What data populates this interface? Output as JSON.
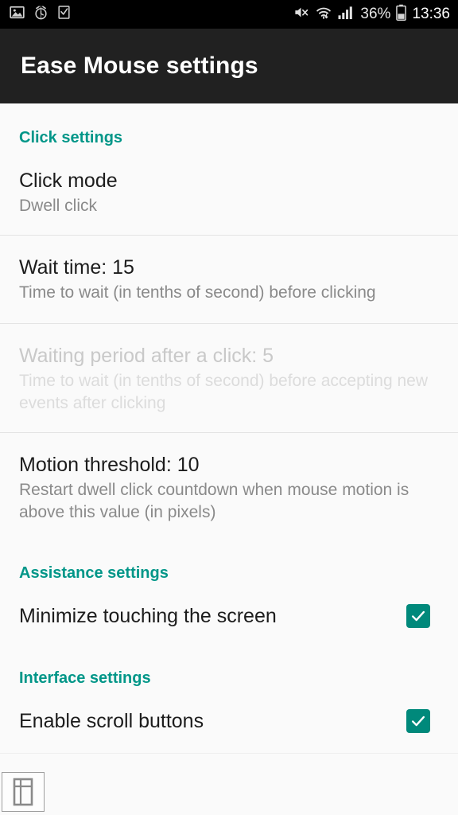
{
  "status_bar": {
    "left_icons": [
      "image-icon",
      "alarm-icon",
      "task-checkbox-icon"
    ],
    "right_icons": [
      "mute-icon",
      "wifi-icon",
      "signal-icon",
      "battery-icon"
    ],
    "battery_percent": "36%",
    "clock": "13:36"
  },
  "toolbar": {
    "title": "Ease Mouse settings"
  },
  "sections": [
    {
      "header": "Click settings",
      "items": [
        {
          "title": "Click mode",
          "summary": "Dwell click",
          "enabled": true,
          "type": "list"
        },
        {
          "title": "Wait time: 15",
          "summary": "Time to wait (in tenths of second) before clicking",
          "enabled": true,
          "type": "seekbar"
        },
        {
          "title": "Waiting period after a click: 5",
          "summary": "Time to wait (in tenths of second) before accepting new events after clicking",
          "enabled": false,
          "type": "seekbar"
        },
        {
          "title": "Motion threshold: 10",
          "summary": "Restart dwell click countdown when mouse motion is above this value (in pixels)",
          "enabled": true,
          "type": "seekbar"
        }
      ]
    },
    {
      "header": "Assistance settings",
      "items": [
        {
          "title": "Minimize touching the screen",
          "summary": "",
          "enabled": true,
          "type": "checkbox",
          "checked": true
        }
      ]
    },
    {
      "header": "Interface settings",
      "items": [
        {
          "title": "Enable scroll buttons",
          "summary": "",
          "enabled": true,
          "type": "checkbox",
          "checked": true
        }
      ]
    }
  ],
  "overlay_button": {
    "icon": "window-panes-icon"
  },
  "colors": {
    "accent": "#009688",
    "checkbox": "#00897b",
    "toolbar_bg": "#212121",
    "status_bg": "#000000",
    "background": "#fafafa",
    "divider": "#e4e4e4",
    "title_text": "#1c1c1c",
    "summary_text": "#8a8a8a",
    "disabled_title_text": "#c9c9c9",
    "disabled_summary_text": "#dcdcdc"
  }
}
